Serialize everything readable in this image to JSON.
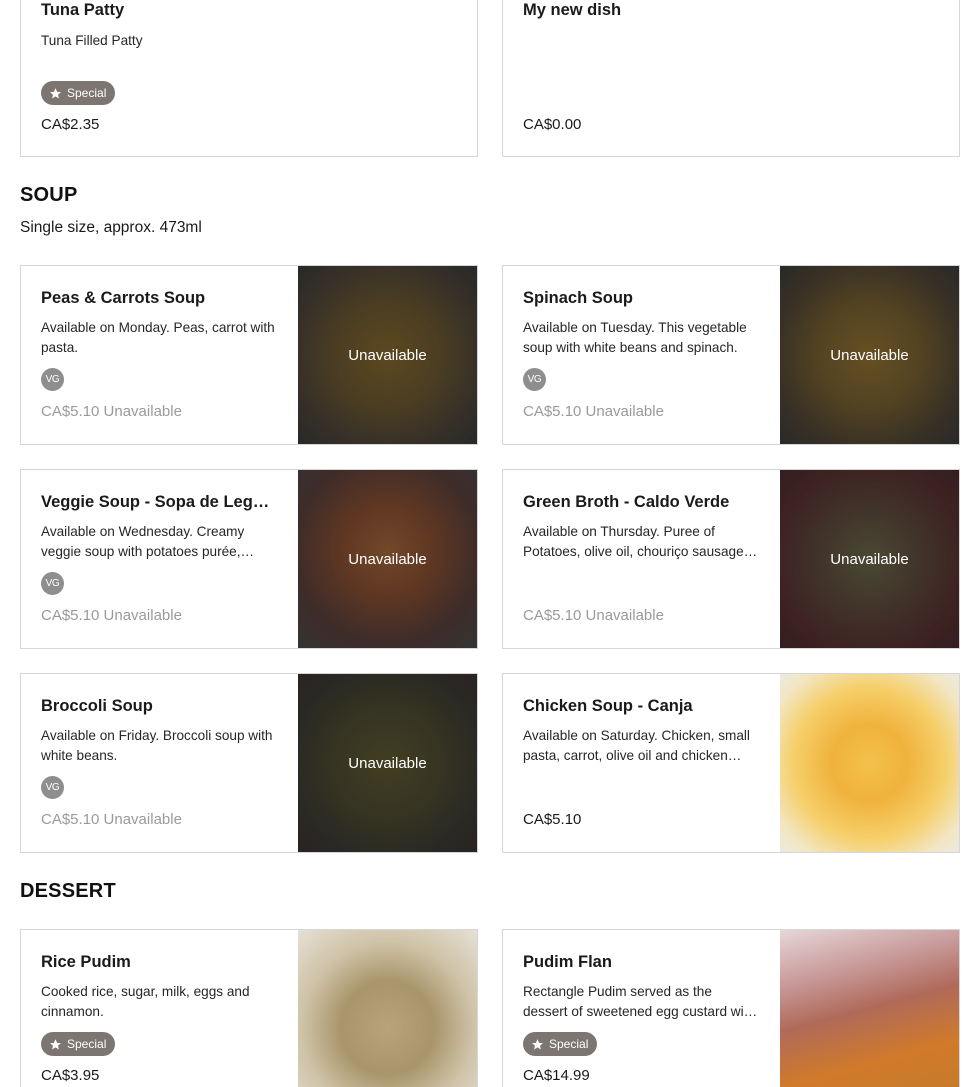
{
  "top_cards": [
    {
      "title": "Tuna Patty",
      "desc": "Tuna Filled Patty",
      "badge": "Special",
      "price": "CA$2.35"
    },
    {
      "title": "My new dish",
      "desc": "",
      "price": "CA$0.00"
    }
  ],
  "soup": {
    "title": "SOUP",
    "subtitle": "Single size, approx. 473ml",
    "items": [
      {
        "title": "Peas & Carrots Soup",
        "desc": "Available on Monday. Peas, carrot with pasta.",
        "tag": "VG",
        "price": "CA$5.10 Unavailable",
        "image_label": "Unavailable"
      },
      {
        "title": "Spinach Soup",
        "desc": "Available on Tuesday. This vegetable soup with white beans and spinach.",
        "tag": "VG",
        "price": "CA$5.10 Unavailable",
        "image_label": "Unavailable"
      },
      {
        "title": "Veggie Soup - Sopa de Legumes",
        "desc": "Available on Wednesday. Creamy veggie soup with potatoes purée, carrots and vegetables.",
        "tag": "VG",
        "price": "CA$5.10 Unavailable",
        "image_label": "Unavailable"
      },
      {
        "title": "Green Broth - Caldo Verde",
        "desc": "Available on Thursday. Puree of Potatoes, olive oil, chouriço sausage and kale.",
        "price": "CA$5.10 Unavailable",
        "image_label": "Unavailable"
      },
      {
        "title": "Broccoli Soup",
        "desc": "Available on Friday. Broccoli soup with white beans.",
        "tag": "VG",
        "price": "CA$5.10 Unavailable",
        "image_label": "Unavailable"
      },
      {
        "title": "Chicken Soup - Canja",
        "desc": "Available on Saturday. Chicken, small pasta, carrot, olive oil and chicken broth.",
        "price": "CA$5.10"
      }
    ]
  },
  "dessert": {
    "title": "DESSERT",
    "items": [
      {
        "title": "Rice Pudim",
        "desc": "Cooked rice, sugar, milk, eggs and cinnamon.",
        "badge": "Special",
        "price": "CA$3.95"
      },
      {
        "title": "Pudim Flan",
        "desc": "Rectangle Pudim served as the dessert of sweetened egg custard with caramel.",
        "badge": "Special",
        "price": "CA$14.99"
      }
    ]
  },
  "icons": {
    "special_badge": "star-icon"
  },
  "colors": {
    "special_badge_bg": "#7d7670",
    "vg_badge_bg": "#8e8e8e",
    "unavailable_text": "#9a9a9a",
    "card_border": "#d6d6d6"
  }
}
